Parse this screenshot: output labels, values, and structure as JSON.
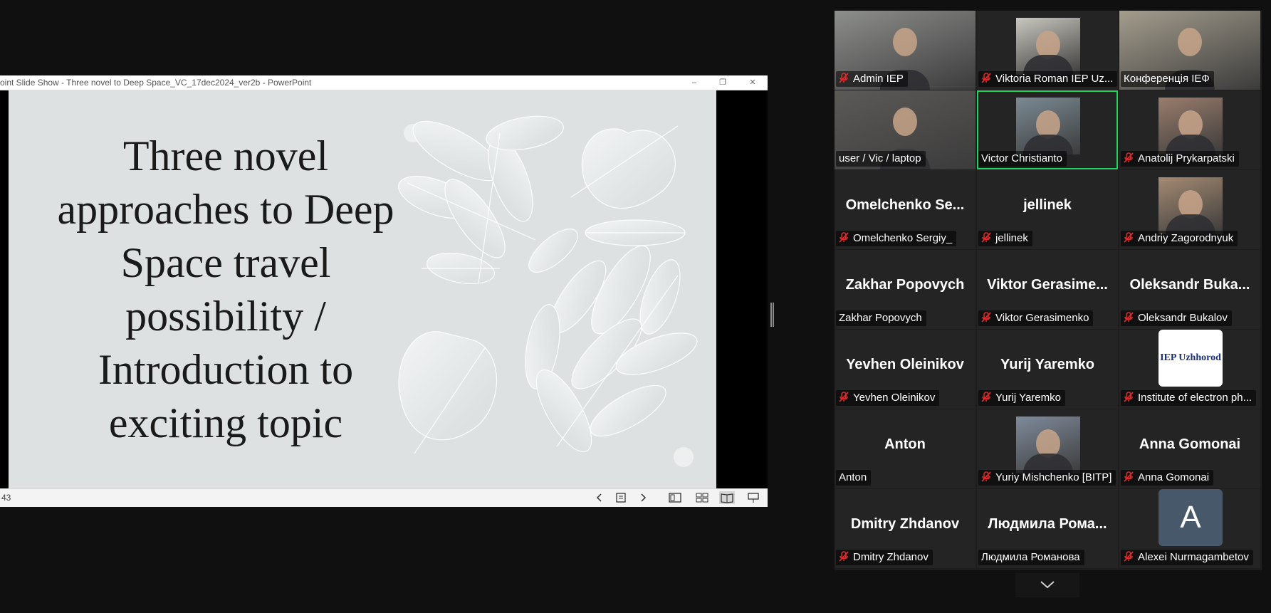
{
  "ppt": {
    "title_bar": "oint Slide Show  -  Three novel to Deep Space_VC_17dec2024_ver2b  -  PowerPoint",
    "minimize": "–",
    "restore": "❐",
    "close": "✕",
    "slide_title": "Three novel approaches to Deep Space travel possibility / Introduction to exciting topic",
    "slide_counter": "43"
  },
  "statusbar_icons": [
    "chevron-left-icon",
    "slide-list-icon",
    "chevron-right-icon",
    "normal-view-icon",
    "slide-sorter-icon",
    "reading-view-icon",
    "slideshow-icon"
  ],
  "colors": {
    "active_speaker": "#23d160",
    "mute_red": "#e02828",
    "slide_bg": "#dde1e2"
  },
  "participants": [
    {
      "label": "Admin IEP",
      "muted": true,
      "video": true
    },
    {
      "label": "Viktoria Roman IEP Uz...",
      "muted": true,
      "video": true
    },
    {
      "label": "Конференція ІЕФ",
      "muted": false,
      "video": true
    },
    {
      "label": "user / Vic / laptop",
      "muted": false,
      "video": true
    },
    {
      "label": "Victor Christianto",
      "muted": false,
      "video": true,
      "active": true
    },
    {
      "label": "Anatolij Prykarpatski",
      "muted": true,
      "video": true
    },
    {
      "big_name": "Omelchenko  Se...",
      "label": "Omelchenko Sergiy_",
      "muted": true
    },
    {
      "big_name": "jellinek",
      "label": "jellinek",
      "muted": true
    },
    {
      "label": "Andriy Zagorodnyuk",
      "muted": true,
      "video": true
    },
    {
      "big_name": "Zakhar Popovych",
      "label": "Zakhar Popovych",
      "muted": false
    },
    {
      "big_name": "Viktor  Gerasime...",
      "label": "Viktor Gerasimenko",
      "muted": true
    },
    {
      "big_name": "Oleksandr  Buka...",
      "label": "Oleksandr Bukalov",
      "muted": true
    },
    {
      "big_name": "Yevhen Oleinikov",
      "label": "Yevhen Oleinikov",
      "muted": true
    },
    {
      "big_name": "Yurij Yaremko",
      "label": "Yurij Yaremko",
      "muted": true
    },
    {
      "label": "Institute of electron ph...",
      "muted": true,
      "logo_text": "IEP Uzhhorod"
    },
    {
      "big_name": "Anton",
      "label": "Anton",
      "muted": false
    },
    {
      "label": "Yuriy Mishchenko [BITP]",
      "muted": true,
      "video": true
    },
    {
      "big_name": "Anna Gomonai",
      "label": "Anna Gomonai",
      "muted": true
    },
    {
      "big_name": "Dmitry Zhdanov",
      "label": "Dmitry Zhdanov",
      "muted": true
    },
    {
      "big_name": "Людмила  Рома...",
      "label": "Людмила Романова",
      "muted": false
    },
    {
      "label": "Alexei Nurmagambetov",
      "muted": true,
      "avatar_letter": "A"
    }
  ],
  "gallery_scroll_icon": "chevron-down-icon"
}
